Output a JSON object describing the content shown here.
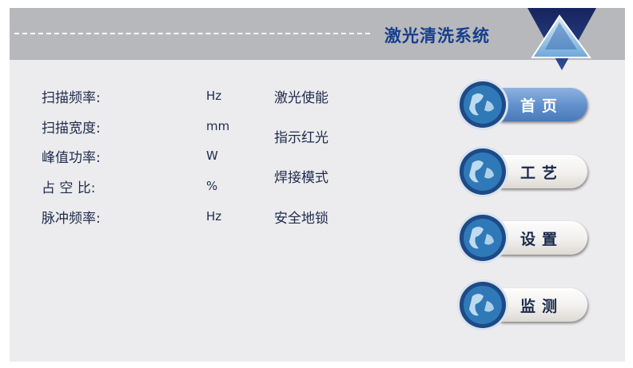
{
  "header": {
    "title": "激光清洗系统"
  },
  "params": [
    {
      "label": "扫描频率:",
      "unit": "Hz"
    },
    {
      "label": "扫描宽度:",
      "unit": "mm"
    },
    {
      "label": "峰值功率:",
      "unit": "W"
    },
    {
      "label": "占 空 比:",
      "unit": "%"
    },
    {
      "label": "脉冲频率:",
      "unit": "Hz"
    }
  ],
  "status": [
    {
      "label": "激光使能"
    },
    {
      "label": "指示红光"
    },
    {
      "label": "焊接模式"
    },
    {
      "label": "安全地锁"
    }
  ],
  "nav": [
    {
      "label": "首页",
      "active": true
    },
    {
      "label": "工艺",
      "active": false
    },
    {
      "label": "设置",
      "active": false
    },
    {
      "label": "监测",
      "active": false
    }
  ],
  "colors": {
    "title": "#163e8f",
    "header_bg": "#b7b8bb",
    "panel_bg": "#ececee",
    "active_button": "#5f8fcc"
  }
}
